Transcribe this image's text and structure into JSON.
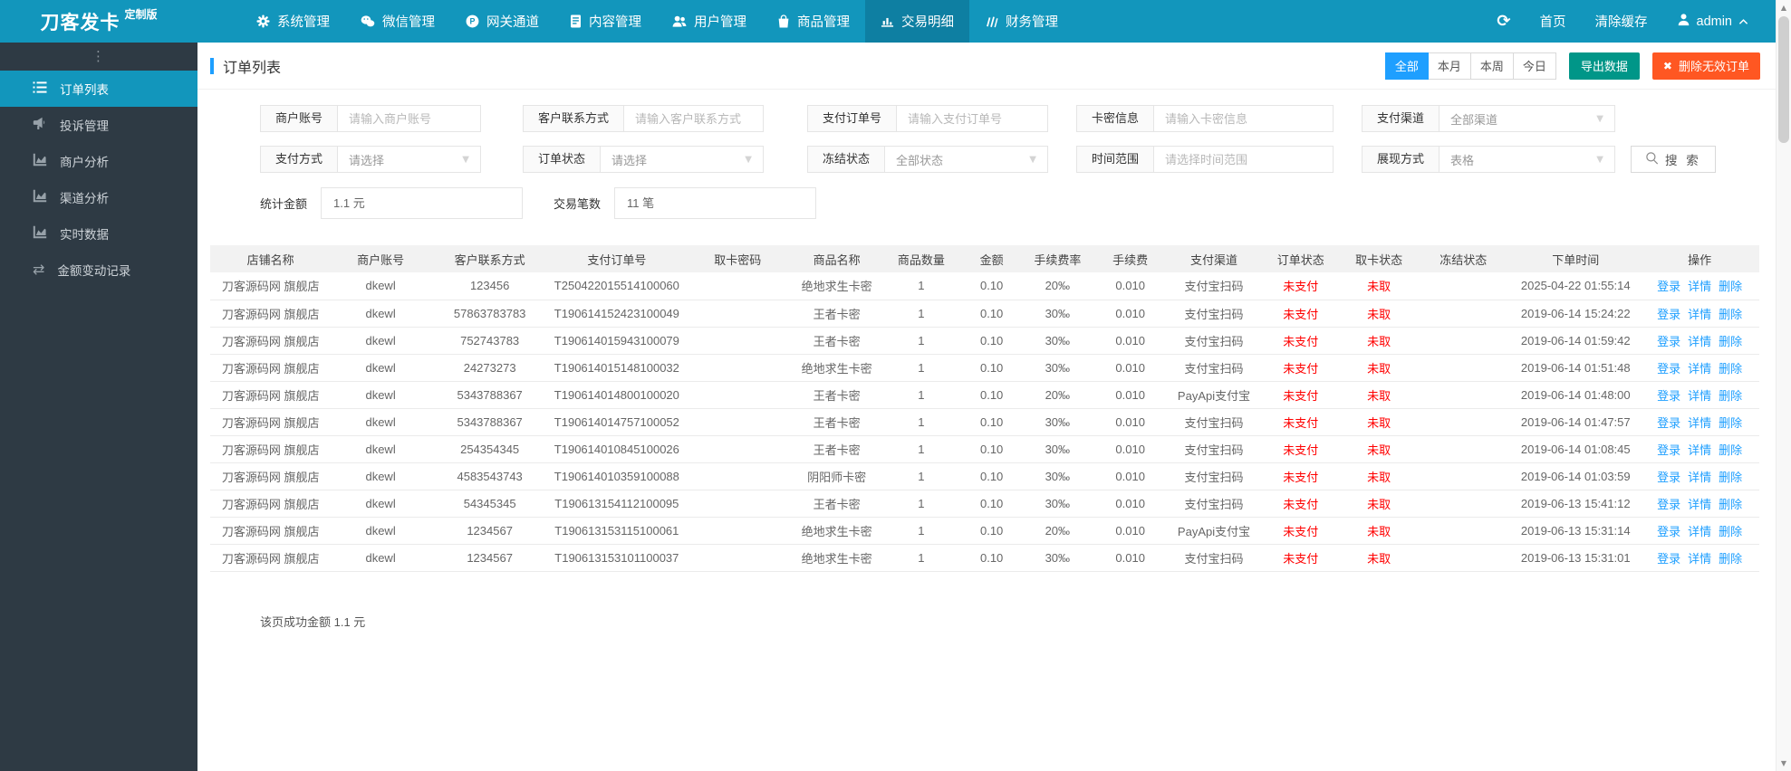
{
  "colors": {
    "navbar_cyan": "#1296BC",
    "navbar_active_tab": "#0E7FA2",
    "sidebar_dark": "#2E3A44",
    "accent_blue": "#1E9FFF",
    "export_teal": "#009688",
    "delete_orange": "#FF5722",
    "status_red": "#FF0000",
    "link_blue": "#1E9FFF"
  },
  "navbar": {
    "brand": "刀客发卡",
    "brand_badge": "定制版",
    "menus": [
      {
        "label": "系统管理",
        "icon": "gear-icon"
      },
      {
        "label": "微信管理",
        "icon": "wechat-icon"
      },
      {
        "label": "网关通道",
        "icon": "gateway-icon"
      },
      {
        "label": "内容管理",
        "icon": "document-icon"
      },
      {
        "label": "用户管理",
        "icon": "users-icon"
      },
      {
        "label": "商品管理",
        "icon": "bag-icon"
      },
      {
        "label": "交易明细",
        "icon": "bar-chart-icon",
        "active": true
      },
      {
        "label": "财务管理",
        "icon": "finance-icon"
      }
    ],
    "home_label": "首页",
    "clear_cache_label": "清除缓存",
    "username": "admin"
  },
  "sidebar": {
    "items": [
      {
        "label": "订单列表",
        "icon": "list-ol-icon",
        "active": true
      },
      {
        "label": "投诉管理",
        "icon": "megaphone-icon"
      },
      {
        "label": "商户分析",
        "icon": "area-chart-icon"
      },
      {
        "label": "渠道分析",
        "icon": "area-chart-icon"
      },
      {
        "label": "实时数据",
        "icon": "area-chart-icon"
      },
      {
        "label": "金额变动记录",
        "icon": "exchange-icon"
      }
    ]
  },
  "page": {
    "title": "订单列表",
    "range_tabs": [
      "全部",
      "本月",
      "本周",
      "今日"
    ],
    "active_range": "全部",
    "export_label": "导出数据",
    "delete_invalid_label": "删除无效订单",
    "search_label": "搜 索",
    "footer_note": "该页成功金额 1.1 元"
  },
  "filters": {
    "row1": [
      {
        "label": "商户账号",
        "placeholder": "请输入商户账号",
        "type": "input"
      },
      {
        "label": "客户联系方式",
        "placeholder": "请输入客户联系方式",
        "type": "input"
      },
      {
        "label": "支付订单号",
        "placeholder": "请输入支付订单号",
        "type": "input"
      },
      {
        "label": "卡密信息",
        "placeholder": "请输入卡密信息",
        "type": "input"
      },
      {
        "label": "支付渠道",
        "value": "全部渠道",
        "type": "select"
      }
    ],
    "row2": [
      {
        "label": "支付方式",
        "value": "请选择",
        "type": "select"
      },
      {
        "label": "订单状态",
        "value": "请选择",
        "type": "select"
      },
      {
        "label": "冻结状态",
        "value": "全部状态",
        "type": "select"
      },
      {
        "label": "时间范围",
        "placeholder": "请选择时间范围",
        "type": "input"
      },
      {
        "label": "展现方式",
        "value": "表格",
        "type": "select"
      }
    ]
  },
  "stats": [
    {
      "label": "统计金额",
      "value": "1.1 元"
    },
    {
      "label": "交易笔数",
      "value": "11 笔"
    }
  ],
  "table": {
    "headers": [
      "店铺名称",
      "商户账号",
      "客户联系方式",
      "支付订单号",
      "取卡密码",
      "商品名称",
      "商品数量",
      "金额",
      "手续费率",
      "手续费",
      "支付渠道",
      "订单状态",
      "取卡状态",
      "冻结状态",
      "下单时间",
      "操作"
    ],
    "row_actions": [
      "登录",
      "详情",
      "删除"
    ],
    "rows": [
      [
        "刀客源码网 旗舰店",
        "dkewl",
        "123456",
        "T250422015514100060",
        "",
        "绝地求生卡密",
        "1",
        "0.10",
        "20‰",
        "0.010",
        "支付宝扫码",
        "未支付",
        "未取",
        "",
        "2025-04-22 01:55:14"
      ],
      [
        "刀客源码网 旗舰店",
        "dkewl",
        "57863783783",
        "T190614152423100049",
        "",
        "王者卡密",
        "1",
        "0.10",
        "30‰",
        "0.010",
        "支付宝扫码",
        "未支付",
        "未取",
        "",
        "2019-06-14 15:24:22"
      ],
      [
        "刀客源码网 旗舰店",
        "dkewl",
        "752743783",
        "T190614015943100079",
        "",
        "王者卡密",
        "1",
        "0.10",
        "30‰",
        "0.010",
        "支付宝扫码",
        "未支付",
        "未取",
        "",
        "2019-06-14 01:59:42"
      ],
      [
        "刀客源码网 旗舰店",
        "dkewl",
        "24273273",
        "T190614015148100032",
        "",
        "绝地求生卡密",
        "1",
        "0.10",
        "30‰",
        "0.010",
        "支付宝扫码",
        "未支付",
        "未取",
        "",
        "2019-06-14 01:51:48"
      ],
      [
        "刀客源码网 旗舰店",
        "dkewl",
        "5343788367",
        "T190614014800100020",
        "",
        "王者卡密",
        "1",
        "0.10",
        "20‰",
        "0.010",
        "PayApi支付宝",
        "未支付",
        "未取",
        "",
        "2019-06-14 01:48:00"
      ],
      [
        "刀客源码网 旗舰店",
        "dkewl",
        "5343788367",
        "T190614014757100052",
        "",
        "王者卡密",
        "1",
        "0.10",
        "30‰",
        "0.010",
        "支付宝扫码",
        "未支付",
        "未取",
        "",
        "2019-06-14 01:47:57"
      ],
      [
        "刀客源码网 旗舰店",
        "dkewl",
        "254354345",
        "T190614010845100026",
        "",
        "王者卡密",
        "1",
        "0.10",
        "30‰",
        "0.010",
        "支付宝扫码",
        "未支付",
        "未取",
        "",
        "2019-06-14 01:08:45"
      ],
      [
        "刀客源码网 旗舰店",
        "dkewl",
        "4583543743",
        "T190614010359100088",
        "",
        "阴阳师卡密",
        "1",
        "0.10",
        "30‰",
        "0.010",
        "支付宝扫码",
        "未支付",
        "未取",
        "",
        "2019-06-14 01:03:59"
      ],
      [
        "刀客源码网 旗舰店",
        "dkewl",
        "54345345",
        "T190613154112100095",
        "",
        "王者卡密",
        "1",
        "0.10",
        "30‰",
        "0.010",
        "支付宝扫码",
        "未支付",
        "未取",
        "",
        "2019-06-13 15:41:12"
      ],
      [
        "刀客源码网 旗舰店",
        "dkewl",
        "1234567",
        "T190613153115100061",
        "",
        "绝地求生卡密",
        "1",
        "0.10",
        "20‰",
        "0.010",
        "PayApi支付宝",
        "未支付",
        "未取",
        "",
        "2019-06-13 15:31:14"
      ],
      [
        "刀客源码网 旗舰店",
        "dkewl",
        "1234567",
        "T190613153101100037",
        "",
        "绝地求生卡密",
        "1",
        "0.10",
        "30‰",
        "0.010",
        "支付宝扫码",
        "未支付",
        "未取",
        "",
        "2019-06-13 15:31:01"
      ]
    ]
  }
}
